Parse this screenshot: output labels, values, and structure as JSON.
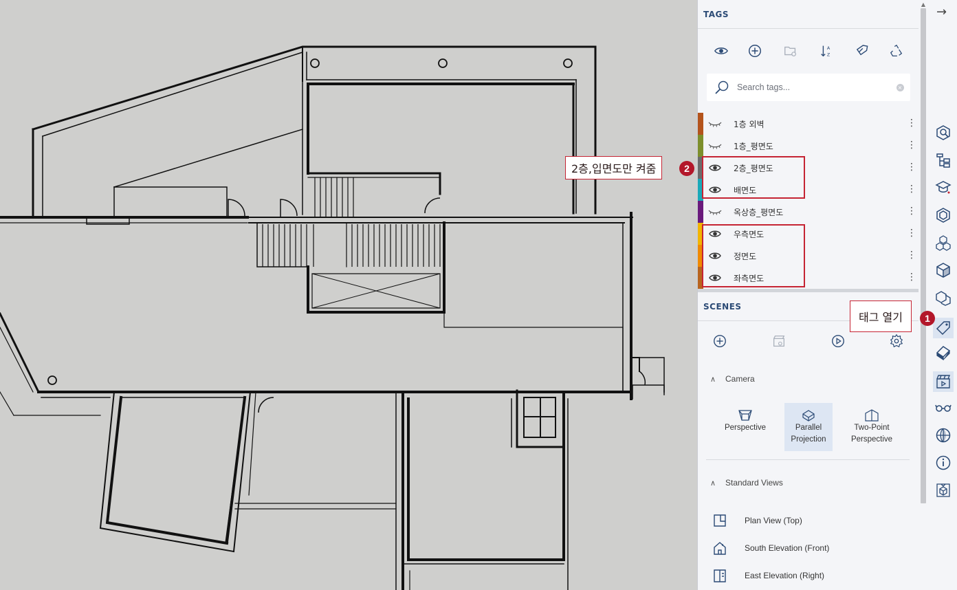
{
  "tags_panel": {
    "title": "TAGS",
    "toolbar": [
      "eye-icon",
      "add-icon",
      "folder-icon",
      "sort-az-icon",
      "tag-paint-icon",
      "purge-icon"
    ],
    "search_placeholder": "Search tags...",
    "tags": [
      {
        "label": "1층 외벽",
        "visible": false,
        "color": "#b4541c"
      },
      {
        "label": "1층_평면도",
        "visible": false,
        "color": "#7d8f2c"
      },
      {
        "label": "2층_평면도",
        "visible": true,
        "color": "#6b6b6b"
      },
      {
        "label": "배면도",
        "visible": true,
        "color": "#1aa9b8"
      },
      {
        "label": "옥상층_평면도",
        "visible": false,
        "color": "#6a1a7c"
      },
      {
        "label": "우측면도",
        "visible": true,
        "color": "#f2b500"
      },
      {
        "label": "정면도",
        "visible": true,
        "color": "#f08a00"
      },
      {
        "label": "좌측면도",
        "visible": true,
        "color": "#b8641e"
      }
    ]
  },
  "scenes_panel": {
    "title": "SCENES",
    "toolbar": [
      "add-scene-icon",
      "scene-thumbnail-icon",
      "play-icon",
      "settings-icon"
    ],
    "camera": {
      "heading": "Camera",
      "options": [
        {
          "label_line1": "Perspective",
          "label_line2": "",
          "active": false
        },
        {
          "label_line1": "Parallel",
          "label_line2": "Projection",
          "active": true
        },
        {
          "label_line1": "Two-Point",
          "label_line2": "Perspective",
          "active": false
        }
      ]
    },
    "standard_views": {
      "heading": "Standard Views",
      "items": [
        "Plan View (Top)",
        "South Elevation (Front)",
        "East Elevation (Right)"
      ]
    }
  },
  "tray": {
    "close_glyph": "→",
    "icons": [
      "entity-info-icon",
      "outliner-icon",
      "instructor-icon",
      "components-icon",
      "materials-icon",
      "styles-icon",
      "solid-tools-icon",
      "tags-icon",
      "soften-edges-icon",
      "scenes-icon",
      "display-icon",
      "geo-location-icon",
      "model-info-icon",
      "3d-warehouse-icon"
    ],
    "active_icon": "tags-icon"
  },
  "annotations": {
    "callout1_text": "태그 열기",
    "callout1_num": "1",
    "callout2_text": "2층,입면도만 켜줌",
    "callout2_num": "2"
  },
  "colors": {
    "accent": "#2b4a75",
    "callout_red": "#c52333",
    "viewport_bg": "#cfcfcd"
  }
}
